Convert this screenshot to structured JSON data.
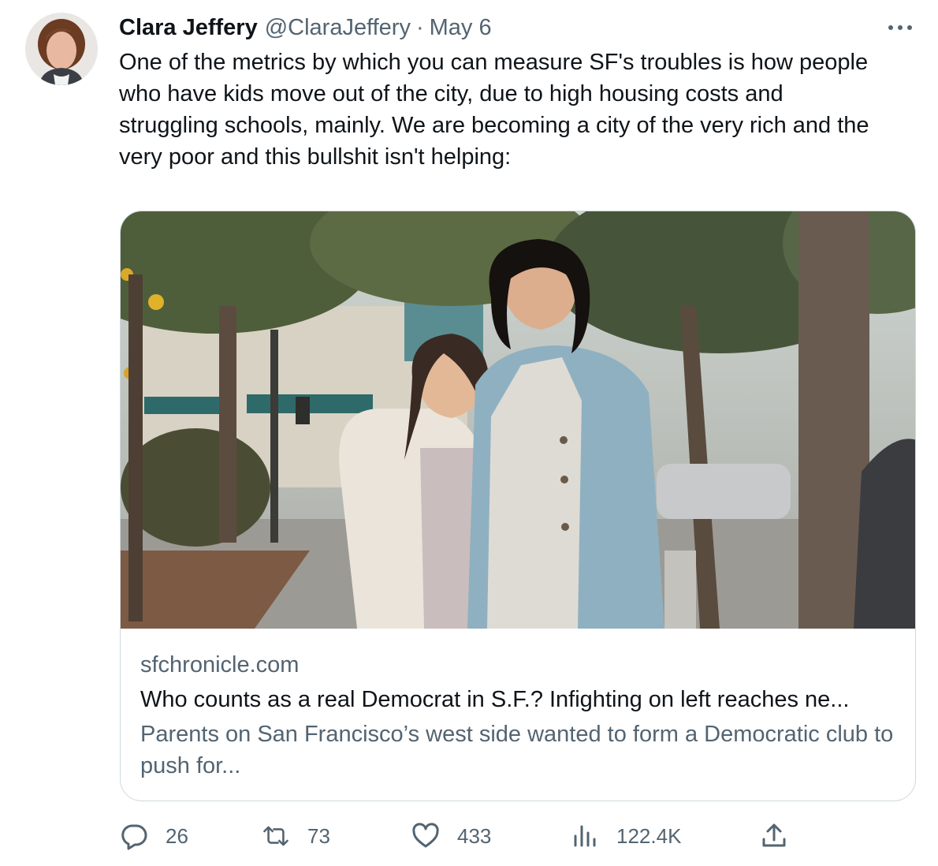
{
  "author": {
    "name": "Clara Jeffery",
    "handle": "@ClaraJeffery",
    "separator": "·",
    "date": "May 6"
  },
  "tweet": {
    "text": "One of the metrics by which you can measure SF's troubles is how people\nwho have kids move out of the city, due to high housing costs and\nstruggling schools, mainly. We are becoming a city of the very rich and the\nvery poor and this bullshit isn't helping:"
  },
  "card": {
    "domain": "sfchronicle.com",
    "title": "Who counts as a real Democrat in S.F.? Infighting on left reaches ne...",
    "description": "Parents on San Francisco’s west side wanted to form a Democratic club to push for..."
  },
  "actions": {
    "replies": "26",
    "retweets": "73",
    "likes": "433",
    "views": "122.4K"
  },
  "icons": {
    "more": "more-dots-icon",
    "reply": "reply-icon",
    "retweet": "retweet-icon",
    "like": "heart-icon",
    "views": "views-icon",
    "share": "share-icon"
  },
  "colors": {
    "text": "#0f1419",
    "secondary": "#536471",
    "border": "#cfd9de"
  }
}
